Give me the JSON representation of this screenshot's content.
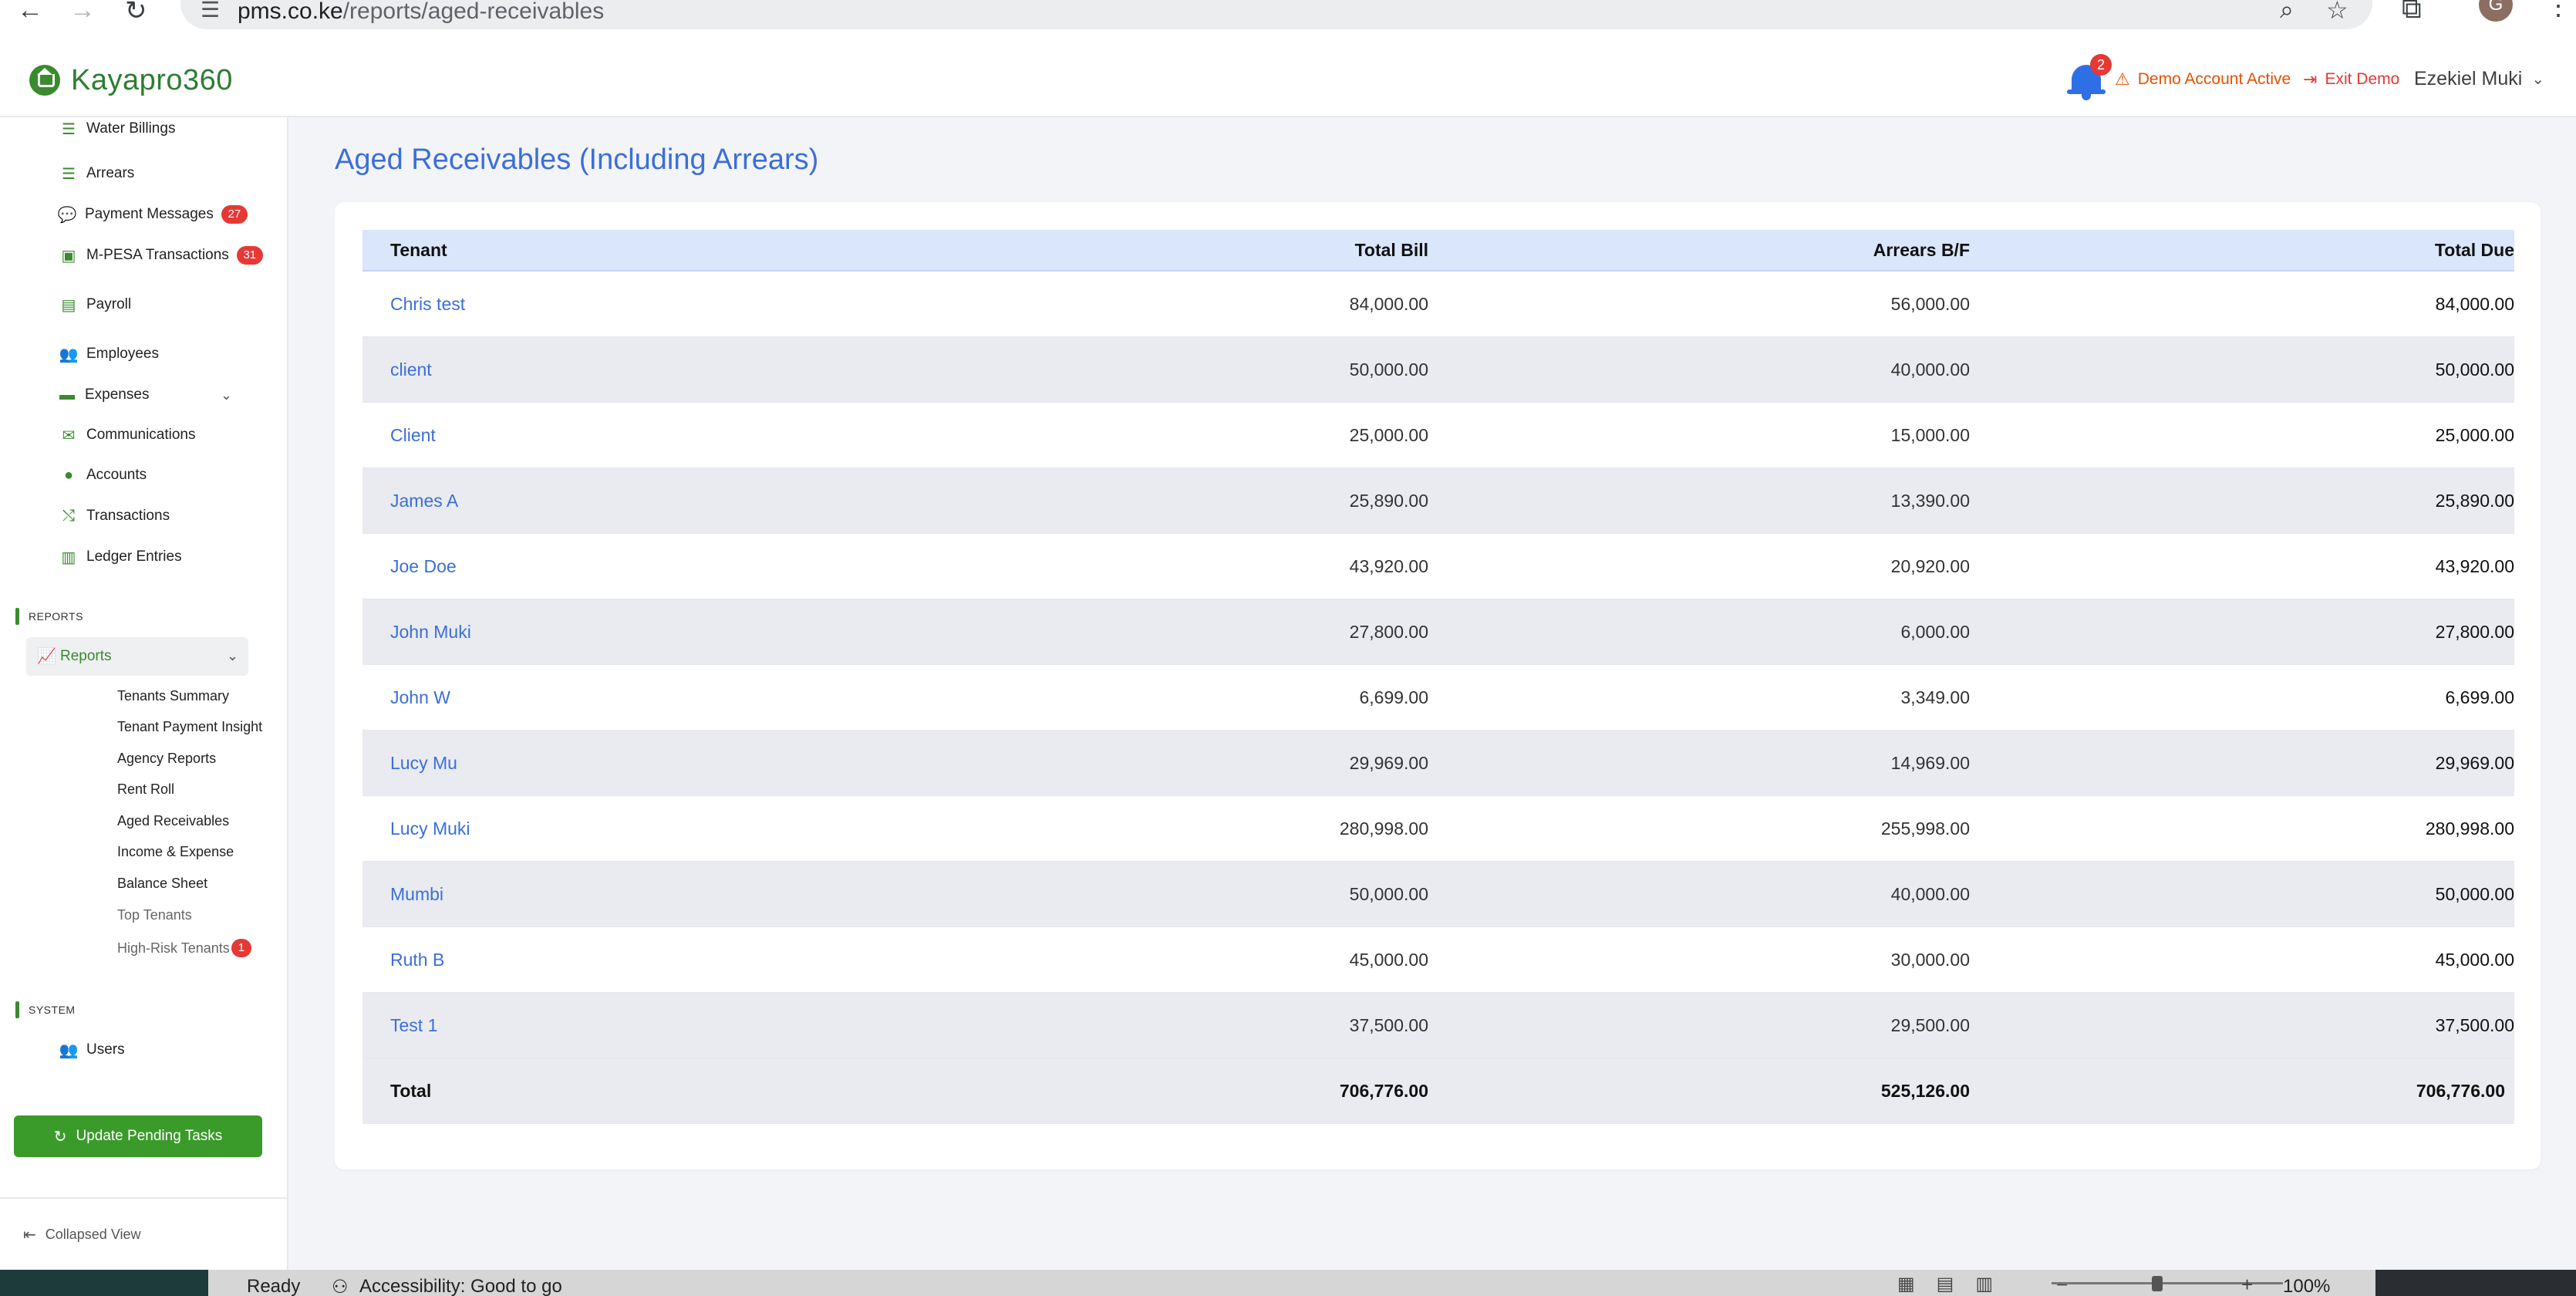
{
  "browser": {
    "url_host": "pms.co.ke",
    "url_path": "/reports/aged-receivables",
    "profile_initial": "G"
  },
  "header": {
    "brand": "Kayapro360",
    "notification_count": "2",
    "demo_status": "Demo Account Active",
    "exit_demo": "Exit Demo",
    "user_name": "Ezekiel Muki"
  },
  "sidebar": {
    "items": [
      {
        "label": "Water Billings",
        "icon": "list-icon"
      },
      {
        "label": "Arrears",
        "icon": "list-icon"
      },
      {
        "label": "Payment Messages",
        "icon": "chat-icon",
        "badge": "27"
      },
      {
        "label": "M-PESA Transactions",
        "icon": "money-icon",
        "badge": "31"
      },
      {
        "label": "Payroll",
        "icon": "id-card-icon"
      },
      {
        "label": "Employees",
        "icon": "users-icon"
      },
      {
        "label": "Expenses",
        "icon": "wallet-icon"
      },
      {
        "label": "Communications",
        "icon": "envelope-icon"
      },
      {
        "label": "Accounts",
        "icon": "piggy-bank-icon"
      },
      {
        "label": "Transactions",
        "icon": "shuffle-icon"
      },
      {
        "label": "Ledger Entries",
        "icon": "book-icon"
      }
    ],
    "section_reports": "REPORTS",
    "reports_label": "Reports",
    "report_items": [
      {
        "label": "Tenants Summary"
      },
      {
        "label": "Tenant Payment Insight"
      },
      {
        "label": "Agency Reports"
      },
      {
        "label": "Rent Roll"
      },
      {
        "label": "Aged Receivables"
      },
      {
        "label": "Income & Expense"
      },
      {
        "label": "Balance Sheet"
      },
      {
        "label": "Top Tenants"
      },
      {
        "label": "High-Risk Tenants",
        "badge": "1"
      }
    ],
    "section_system": "SYSTEM",
    "system_items": [
      {
        "label": "Users",
        "icon": "users-icon"
      }
    ],
    "update_button": "Update Pending Tasks",
    "collapse_label": "Collapsed View"
  },
  "main": {
    "title": "Aged Receivables (Including Arrears)",
    "table": {
      "columns": [
        "Tenant",
        "Total Bill",
        "Arrears B/F",
        "Total Due"
      ],
      "rows": [
        {
          "tenant": "Chris test",
          "total_bill": "84,000.00",
          "arrears_bf": "56,000.00",
          "total_due": "84,000.00"
        },
        {
          "tenant": "client",
          "total_bill": "50,000.00",
          "arrears_bf": "40,000.00",
          "total_due": "50,000.00"
        },
        {
          "tenant": "Client",
          "total_bill": "25,000.00",
          "arrears_bf": "15,000.00",
          "total_due": "25,000.00"
        },
        {
          "tenant": "James A",
          "total_bill": "25,890.00",
          "arrears_bf": "13,390.00",
          "total_due": "25,890.00"
        },
        {
          "tenant": "Joe Doe",
          "total_bill": "43,920.00",
          "arrears_bf": "20,920.00",
          "total_due": "43,920.00"
        },
        {
          "tenant": "John Muki",
          "total_bill": "27,800.00",
          "arrears_bf": "6,000.00",
          "total_due": "27,800.00"
        },
        {
          "tenant": "John W",
          "total_bill": "6,699.00",
          "arrears_bf": "3,349.00",
          "total_due": "6,699.00"
        },
        {
          "tenant": "Lucy Mu",
          "total_bill": "29,969.00",
          "arrears_bf": "14,969.00",
          "total_due": "29,969.00"
        },
        {
          "tenant": "Lucy Muki",
          "total_bill": "280,998.00",
          "arrears_bf": "255,998.00",
          "total_due": "280,998.00"
        },
        {
          "tenant": "Mumbi",
          "total_bill": "50,000.00",
          "arrears_bf": "40,000.00",
          "total_due": "50,000.00"
        },
        {
          "tenant": "Ruth B",
          "total_bill": "45,000.00",
          "arrears_bf": "30,000.00",
          "total_due": "45,000.00"
        },
        {
          "tenant": "Test 1",
          "total_bill": "37,500.00",
          "arrears_bf": "29,500.00",
          "total_due": "37,500.00"
        }
      ],
      "total": {
        "label": "Total",
        "total_bill": "706,776.00",
        "arrears_bf": "525,126.00",
        "total_due": "706,776.00"
      }
    }
  },
  "statusbar": {
    "ready": "Ready",
    "accessibility": "Accessibility: Good to go",
    "zoom": "100%"
  },
  "colors": {
    "brand_green": "#3a8a2e",
    "link_blue": "#3b6fd8",
    "header_row": "#d9e6fb",
    "badge_red": "#e53935",
    "demo_orange": "#e65100"
  }
}
